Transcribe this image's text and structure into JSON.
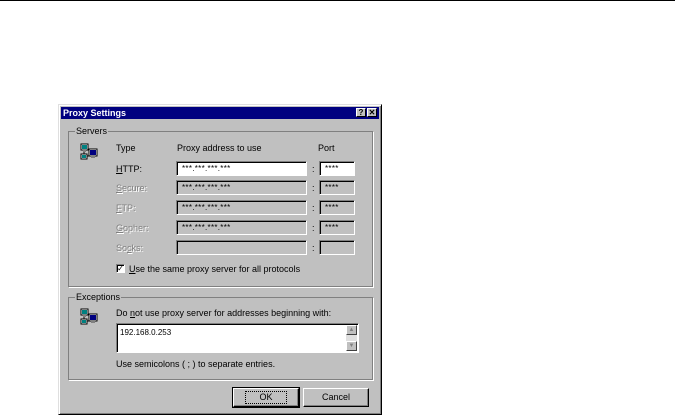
{
  "dialog": {
    "title": "Proxy Settings",
    "help_glyph": "?",
    "close_glyph": "✕"
  },
  "servers": {
    "group_label": "Servers",
    "col_type": "Type",
    "col_address": "Proxy address to use",
    "col_port": "Port",
    "rows": [
      {
        "label": "HTTP:",
        "mnemonic": "H",
        "rest": "TTP:",
        "address": "***.***.***.***",
        "port": "****",
        "state": "enabled"
      },
      {
        "label": "Secure:",
        "mnemonic": "S",
        "rest": "ecure:",
        "address": "***.***.***.***",
        "port": "****",
        "state": "disabled"
      },
      {
        "label": "FTP:",
        "mnemonic": "F",
        "rest": "TP:",
        "address": "***.***.***.***",
        "port": "****",
        "state": "disabled"
      },
      {
        "label": "Gopher:",
        "mnemonic": "G",
        "rest": "opher:",
        "address": "***.***.***.***",
        "port": "****",
        "state": "disabled"
      },
      {
        "label": "Socks:",
        "pre": "So",
        "mnemonic": "c",
        "rest": "ks:",
        "address": "",
        "port": "",
        "state": "disabled"
      }
    ],
    "separator": ":",
    "same_proxy_checked": true,
    "same_proxy_pre": "",
    "same_proxy_mnemonic": "U",
    "same_proxy_rest": "se the same proxy server for all protocols"
  },
  "exceptions": {
    "group_label": "Exceptions",
    "instruction_pre": "Do ",
    "instruction_mnemonic": "n",
    "instruction_rest": "ot use proxy server for addresses beginning with:",
    "value": "192.168.0.253",
    "hint": "Use semicolons ( ; ) to separate entries."
  },
  "buttons": {
    "ok": "OK",
    "cancel": "Cancel"
  },
  "icons": {
    "servers": "network-computers-icon",
    "exceptions": "network-computers-icon"
  }
}
